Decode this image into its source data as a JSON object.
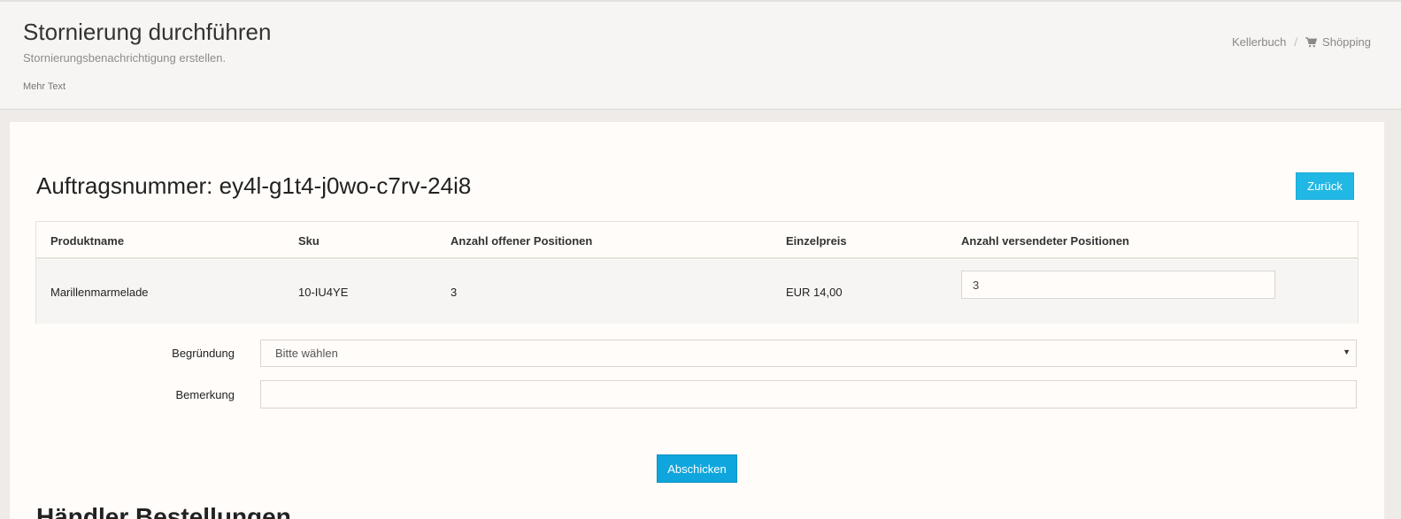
{
  "header": {
    "title": "Stornierung durchführen",
    "subtitle": "Stornierungsbenachrichtigung erstellen.",
    "more_text": "Mehr Text",
    "breadcrumb": {
      "first": "Kellerbuch",
      "separator": "/",
      "second": "Shöpping",
      "second_icon": "cart-icon"
    }
  },
  "order": {
    "title": "Auftragsnummer: ey4l-g1t4-j0wo-c7rv-24i8",
    "back_label": "Zurück"
  },
  "table": {
    "columns": [
      "Produktname",
      "Sku",
      "Anzahl offener Positionen",
      "Einzelpreis",
      "Anzahl versendeter Positionen"
    ],
    "rows": [
      {
        "product": "Marillenmarmelade",
        "sku": "10-IU4YE",
        "open": "3",
        "price": "EUR 14,00",
        "shipped_value": "3"
      }
    ]
  },
  "form": {
    "reason_label": "Begründung",
    "reason_selected": "Bitte wählen",
    "remark_label": "Bemerkung",
    "remark_value": "",
    "submit_label": "Abschicken"
  },
  "next_section": {
    "title": "Händler Bestellungen"
  },
  "colors": {
    "accent": "#22b8e5",
    "submit": "#0fa6dd"
  }
}
